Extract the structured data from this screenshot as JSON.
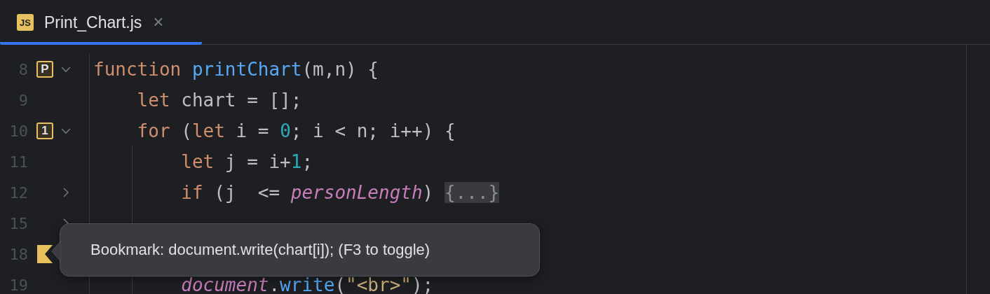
{
  "tab": {
    "icon_label": "JS",
    "title": "Print_Chart.js",
    "close": "×",
    "selected": true
  },
  "lines": [
    {
      "number": "8",
      "marker": {
        "kind": "mnemonic",
        "label": "P"
      },
      "fold": {
        "expanded": true
      },
      "tokens": [
        {
          "kind": "keyword",
          "text": "function "
        },
        {
          "kind": "function",
          "text": "printChart"
        },
        {
          "kind": "plain",
          "text": "(m,n) {"
        }
      ]
    },
    {
      "number": "9",
      "tokens": [
        {
          "kind": "keyword",
          "text": "    let "
        },
        {
          "kind": "plain",
          "text": "chart = [];"
        }
      ]
    },
    {
      "number": "10",
      "marker": {
        "kind": "mnemonic",
        "label": "1"
      },
      "fold": {
        "expanded": true
      },
      "tokens": [
        {
          "kind": "keyword",
          "text": "    for "
        },
        {
          "kind": "plain",
          "text": "("
        },
        {
          "kind": "keyword",
          "text": "let "
        },
        {
          "kind": "plain",
          "text": "i = "
        },
        {
          "kind": "number",
          "text": "0"
        },
        {
          "kind": "plain",
          "text": "; i < n; i++) {"
        }
      ]
    },
    {
      "number": "11",
      "tokens": [
        {
          "kind": "keyword",
          "text": "        let "
        },
        {
          "kind": "plain",
          "text": "j = i+"
        },
        {
          "kind": "number",
          "text": "1"
        },
        {
          "kind": "plain",
          "text": ";"
        }
      ]
    },
    {
      "number": "12",
      "fold": {
        "expanded": false
      },
      "tokens": [
        {
          "kind": "keyword",
          "text": "        if "
        },
        {
          "kind": "plain",
          "text": "(j  <= "
        },
        {
          "kind": "global",
          "text": "personLength"
        },
        {
          "kind": "plain",
          "text": ") "
        },
        {
          "kind": "folded",
          "text": "{...}"
        }
      ]
    },
    {
      "number": "15",
      "fold": {
        "expanded": false
      }
    },
    {
      "number": "18",
      "marker": {
        "kind": "bookmark"
      }
    },
    {
      "number": "19",
      "tokens": [
        {
          "kind": "global",
          "text": "        document"
        },
        {
          "kind": "plain",
          "text": "."
        },
        {
          "kind": "function",
          "text": "write"
        },
        {
          "kind": "plain",
          "text": "("
        },
        {
          "kind": "string",
          "text": "\"<br>\""
        },
        {
          "kind": "plain",
          "text": ");"
        }
      ]
    }
  ],
  "tooltip": {
    "text": "Bookmark: document.write(chart[i]); (F3 to toggle)"
  }
}
